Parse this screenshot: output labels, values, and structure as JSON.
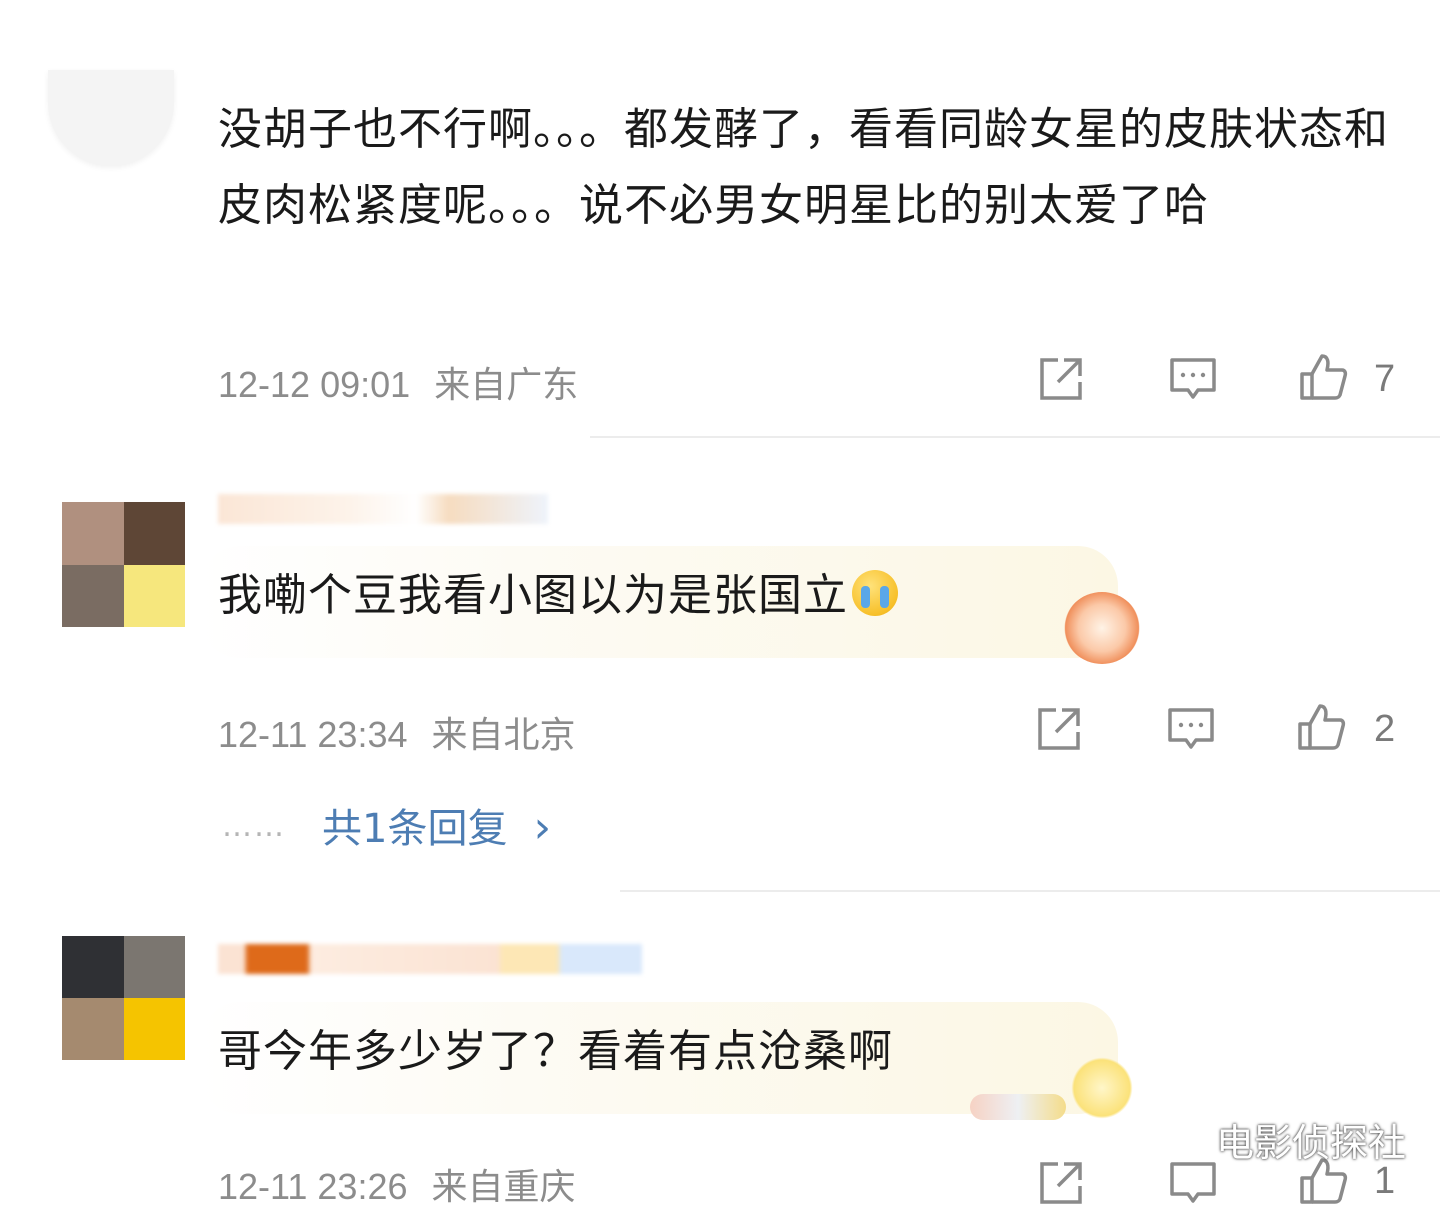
{
  "comments": [
    {
      "text": "没胡子也不行啊。。。都发酵了，看看同龄女星的皮肤状态和皮肉松紧度呢。。。说不必男女明星比的别太爱了哈",
      "time": "12-12 09:01",
      "location": "来自广东",
      "likes": "7"
    },
    {
      "text": "我嘞个豆我看小图以为是张国立",
      "emoji": "crying-face",
      "time": "12-11 23:34",
      "location": "来自北京",
      "likes": "2",
      "replies_label": "共1条回复",
      "replies_dots": "……",
      "replies_arrow": "›"
    },
    {
      "text": "哥今年多少岁了？看着有点沧桑啊",
      "time": "12-11 23:26",
      "location": "来自重庆",
      "likes": "1"
    }
  ],
  "watermark": "电影侦探社",
  "colors": {
    "reply_link": "#4d7db3",
    "meta_gray": "#8c8c8c",
    "icon_gray": "#7a7a7a"
  },
  "icons": [
    "share-icon",
    "comment-icon",
    "like-icon"
  ]
}
